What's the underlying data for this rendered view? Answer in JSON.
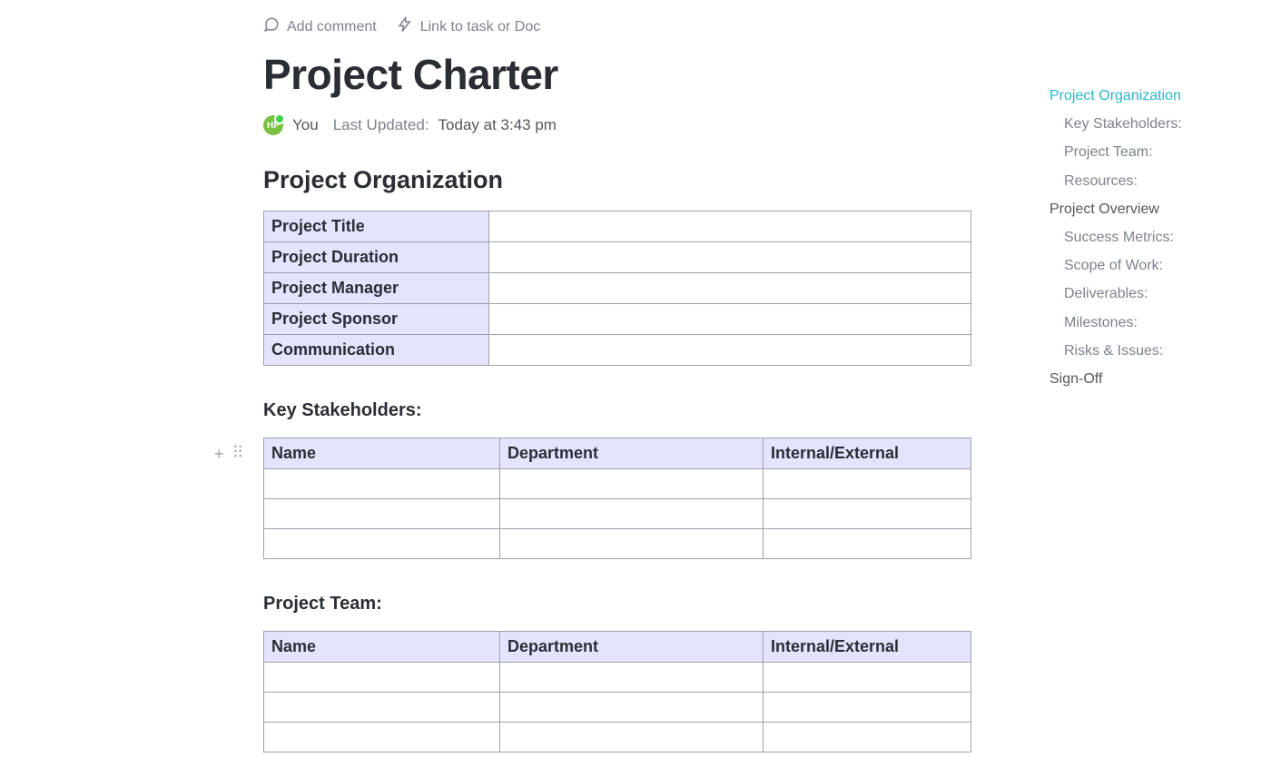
{
  "toolbar": {
    "addComment": "Add comment",
    "linkToTask": "Link to task or Doc"
  },
  "doc": {
    "title": "Project Charter",
    "avatarInitials": "HP",
    "metaYou": "You",
    "metaUpdatedLabel": "Last Updated:",
    "metaUpdatedValue": "Today at 3:43 pm"
  },
  "sections": {
    "orgHeading": "Project Organization",
    "orgRows": [
      "Project Title",
      "Project Duration",
      "Project Manager",
      "Project Sponsor",
      "Communication"
    ],
    "stakeholdersHeading": "Key Stakeholders:",
    "stakeholderColumns": [
      "Name",
      "Department",
      "Internal/External"
    ],
    "teamHeading": "Project Team:",
    "teamColumns": [
      "Name",
      "Department",
      "Internal/External"
    ]
  },
  "outline": [
    {
      "label": "Project Organization",
      "level": 1,
      "active": true
    },
    {
      "label": "Key Stakeholders:",
      "level": 2,
      "active": false
    },
    {
      "label": "Project Team:",
      "level": 2,
      "active": false
    },
    {
      "label": "Resources:",
      "level": 2,
      "active": false
    },
    {
      "label": "Project Overview",
      "level": 1,
      "active": false
    },
    {
      "label": "Success Metrics:",
      "level": 2,
      "active": false
    },
    {
      "label": "Scope of Work:",
      "level": 2,
      "active": false
    },
    {
      "label": "Deliverables:",
      "level": 2,
      "active": false
    },
    {
      "label": "Milestones:",
      "level": 2,
      "active": false
    },
    {
      "label": "Risks & Issues:",
      "level": 2,
      "active": false
    },
    {
      "label": "Sign-Off",
      "level": 1,
      "active": false
    }
  ]
}
